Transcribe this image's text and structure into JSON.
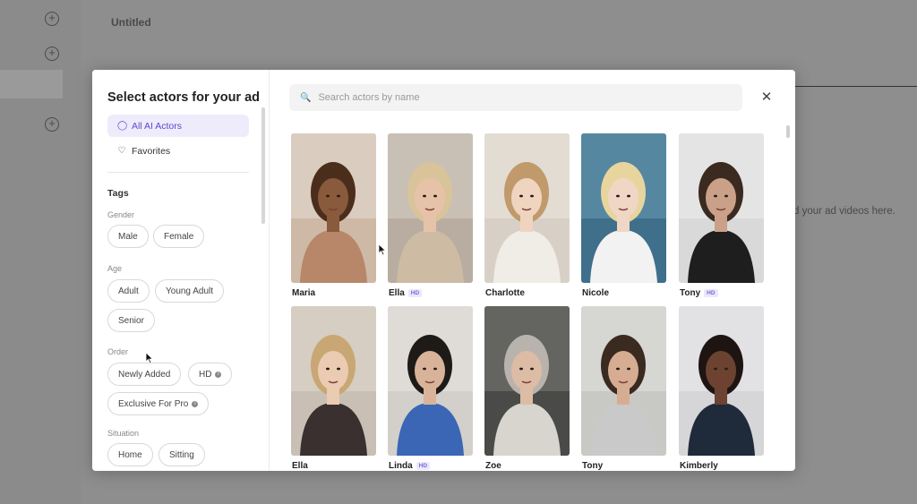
{
  "background": {
    "doc_title": "Untitled",
    "hint_text": "d your ad videos here."
  },
  "modal": {
    "title": "Select actors for your ad",
    "nav": [
      {
        "label": "All AI Actors",
        "icon": "user-icon",
        "active": true
      },
      {
        "label": "Favorites",
        "icon": "heart-icon",
        "active": false
      }
    ],
    "tags_title": "Tags",
    "groups": {
      "gender": {
        "label": "Gender",
        "chips": [
          "Male",
          "Female"
        ]
      },
      "age": {
        "label": "Age",
        "chips": [
          "Adult",
          "Young Adult",
          "Senior"
        ]
      },
      "order": {
        "label": "Order",
        "chips": [
          "Newly Added",
          "HD",
          "Exclusive For Pro"
        ]
      },
      "situation": {
        "label": "Situation",
        "chips": [
          "Home",
          "Sitting"
        ]
      }
    },
    "search": {
      "placeholder": "Search actors by name",
      "value": ""
    },
    "close_label": "✕",
    "hd_badge": "HD"
  },
  "actors": [
    {
      "name": "Maria",
      "hd": false,
      "bg": "#cdb9a6",
      "wall": "#e6ddd3",
      "skin": "#8a5a3c",
      "hair": "#4a2e1b",
      "top": "#b88668"
    },
    {
      "name": "Ella",
      "hd": true,
      "bg": "#b8ada0",
      "wall": "#d6cfc5",
      "skin": "#e6c3a8",
      "hair": "#d9c39a",
      "top": "#cdbba3"
    },
    {
      "name": "Charlotte",
      "hd": false,
      "bg": "#d8d0c6",
      "wall": "#ebe6df",
      "skin": "#efd4c0",
      "hair": "#c09a6b",
      "top": "#f0ece6"
    },
    {
      "name": "Nicole",
      "hd": false,
      "bg": "#3f6f8a",
      "wall": "#6a9bb4",
      "skin": "#f0d6c4",
      "hair": "#e8d59e",
      "top": "#f2f2f2"
    },
    {
      "name": "Tony",
      "hd": true,
      "bg": "#d9d9d9",
      "wall": "#ededed",
      "skin": "#caa089",
      "hair": "#3a2a20",
      "top": "#1e1e1e"
    },
    {
      "name": "Ella",
      "hd": false,
      "bg": "#c9bfb4",
      "wall": "#e0d8cf",
      "skin": "#eccbb3",
      "hair": "#c8a774",
      "top": "#3a3030"
    },
    {
      "name": "Linda",
      "hd": true,
      "bg": "#d3cfca",
      "wall": "#e9e6e2",
      "skin": "#d8b39a",
      "hair": "#1e1a18",
      "top": "#3b66b5"
    },
    {
      "name": "Zoe",
      "hd": false,
      "bg": "#4a4a48",
      "wall": "#7a7a74",
      "skin": "#dcbca5",
      "hair": "#b8b4ad",
      "top": "#d8d4ce"
    },
    {
      "name": "Tony",
      "hd": false,
      "bg": "#c8c8c4",
      "wall": "#e2e2de",
      "skin": "#d6ad92",
      "hair": "#3a2a20",
      "top": "#c9c9c9"
    },
    {
      "name": "Kimberly",
      "hd": false,
      "bg": "#d6d6d8",
      "wall": "#ececee",
      "skin": "#6b4330",
      "hair": "#1e1412",
      "top": "#1f2a3a"
    }
  ]
}
